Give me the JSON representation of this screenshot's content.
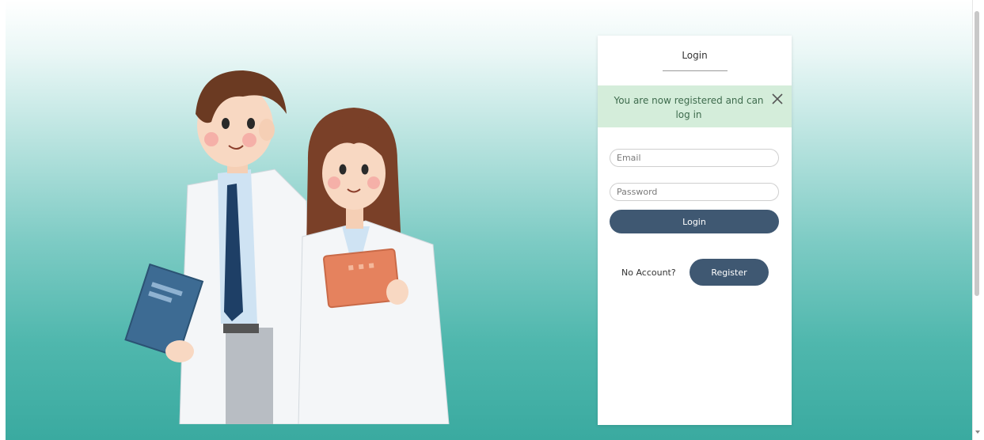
{
  "login_card": {
    "title": "Login",
    "alert": {
      "message": "You are now registered and can log in",
      "close_icon": "close-icon"
    },
    "email": {
      "placeholder": "Email",
      "value": ""
    },
    "password": {
      "placeholder": "Password",
      "value": ""
    },
    "login_button": "Login",
    "no_account_text": "No Account?",
    "register_button": "Register"
  },
  "illustration": {
    "subject": "two-doctors-illustration"
  },
  "colors": {
    "button": "#3f5872",
    "alert_bg": "#d4edda",
    "alert_text": "#3e6b4d",
    "background_teal": "#3aaaa0"
  }
}
